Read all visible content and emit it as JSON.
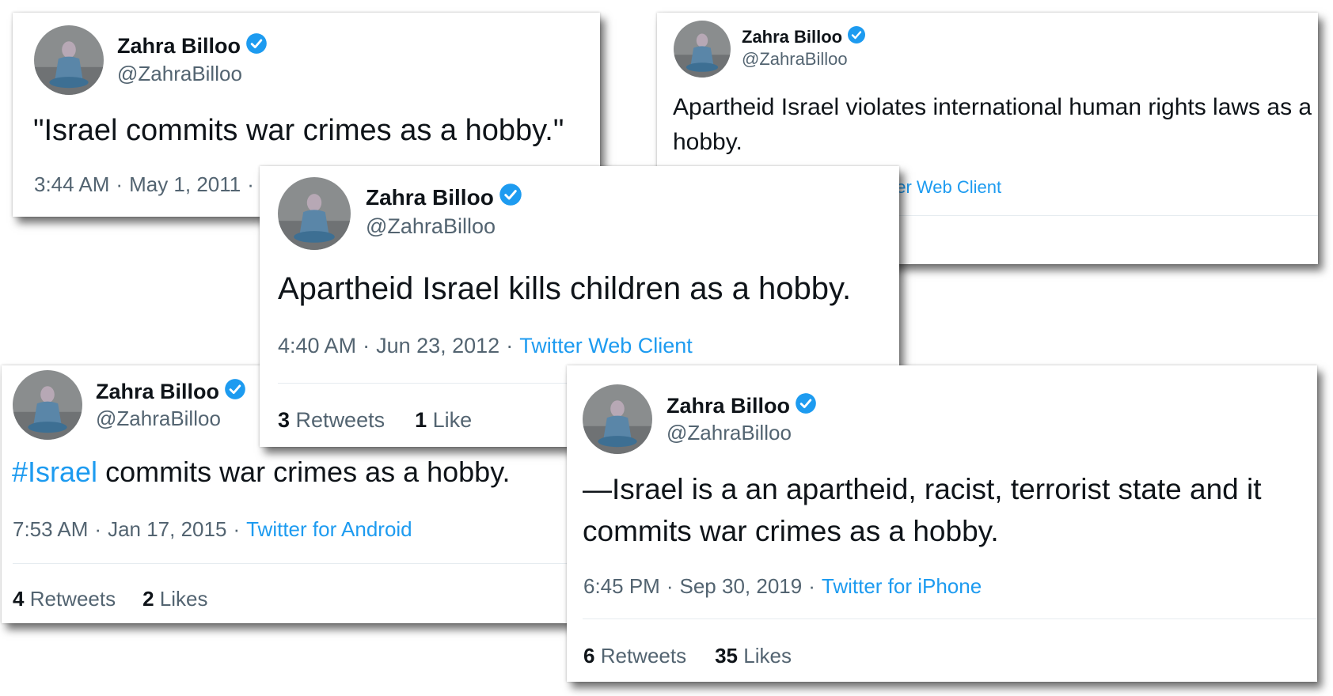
{
  "author": {
    "name": "Zahra Billoo",
    "handle": "@ZahraBilloo",
    "verified_icon": "verified-badge-icon",
    "verified_color": "#1d9bf0"
  },
  "tweets": [
    {
      "text": "\"Israel commits war crimes as a hobby.\"",
      "time": "3:44 AM",
      "date": "May 1, 2011",
      "client": ""
    },
    {
      "text": "Apartheid Israel violates international human rights laws as a hobby.",
      "client_visible": "tter Web Client"
    },
    {
      "text": "Apartheid Israel kills children as a hobby.",
      "time": "4:40 AM",
      "date": "Jun 23, 2012",
      "client": "Twitter Web Client",
      "retweets": "3",
      "retweets_label": "Retweets",
      "likes": "1",
      "likes_label": "Like"
    },
    {
      "hashtag": "#Israel",
      "text": " commits war crimes as a hobby.",
      "time": "7:53 AM",
      "date": "Jan 17, 2015",
      "client": "Twitter for Android",
      "retweets": "4",
      "retweets_label": "Retweets",
      "likes": "2",
      "likes_label": "Likes"
    },
    {
      "text": "—Israel is a an apartheid, racist, terrorist state and it commits war crimes as a hobby.",
      "time": "6:45 PM",
      "date": "Sep 30, 2019",
      "client": "Twitter for iPhone",
      "retweets": "6",
      "retweets_label": "Retweets",
      "likes": "35",
      "likes_label": "Likes"
    }
  ],
  "dot": "·",
  "colors": {
    "text": "#0f1419",
    "secondary": "#536471",
    "link": "#1d9bf0"
  }
}
